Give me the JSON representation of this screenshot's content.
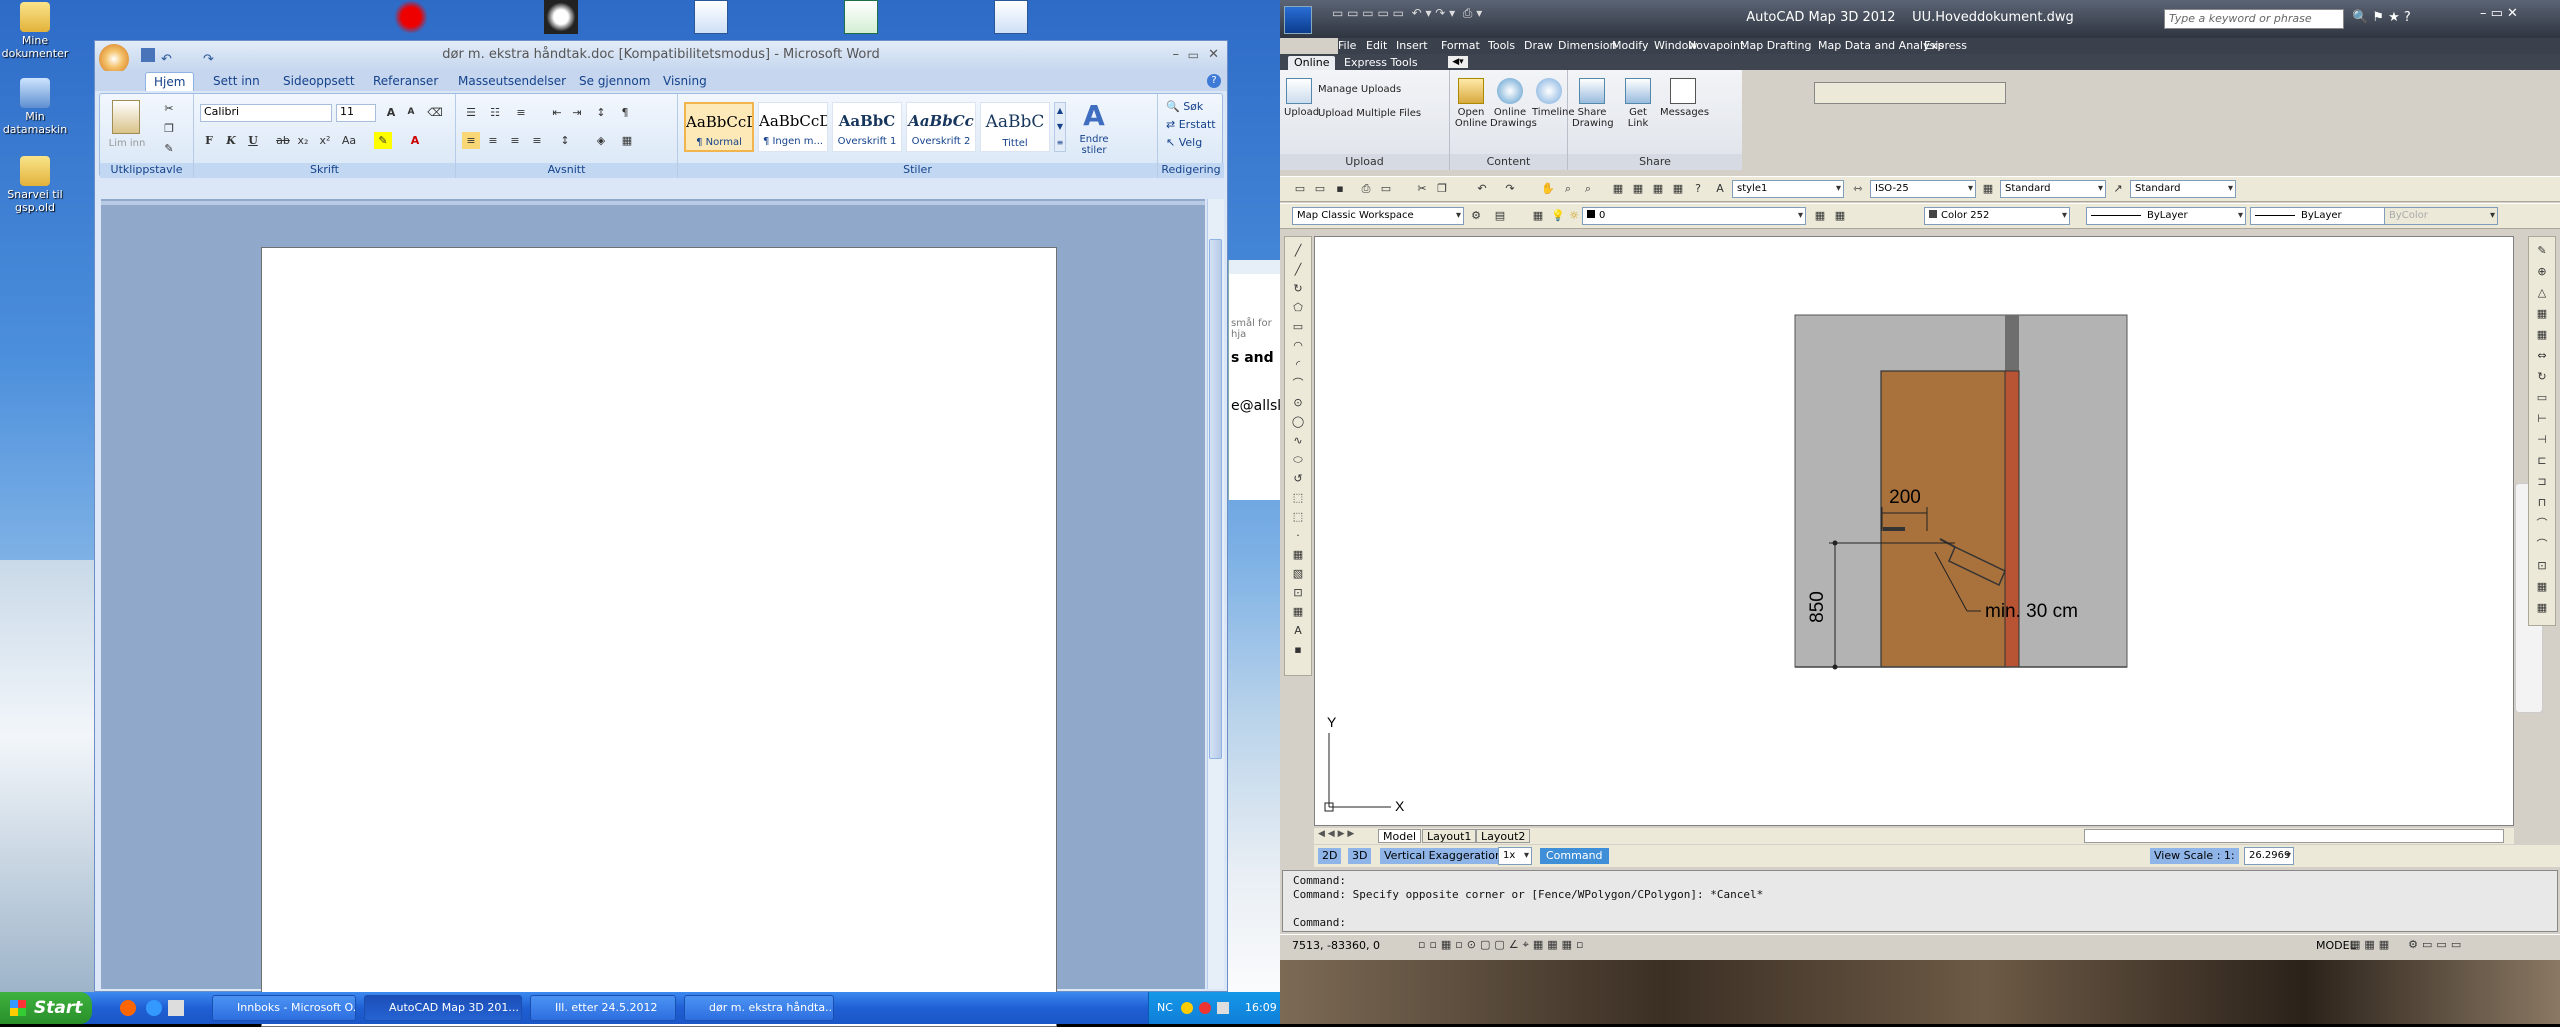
{
  "desktop": {
    "icons": [
      {
        "label": "Mine\ndokumenter"
      },
      {
        "label": "Min\ndatamaskin"
      },
      {
        "label": "Snarvei til\ngsp.old"
      }
    ]
  },
  "word": {
    "title": "dør m. ekstra håndtak.doc [Kompatibilitetsmodus] - Microsoft Word",
    "tabs": [
      "Hjem",
      "Sett inn",
      "Sideoppsett",
      "Referanser",
      "Masseutsendelser",
      "Se gjennom",
      "Visning"
    ],
    "font_name": "Calibri",
    "font_size": "11",
    "paste_label": "Lim inn",
    "groups": {
      "clipboard": "Utklippstavle",
      "font": "Skrift",
      "paragraph": "Avsnitt",
      "styles": "Stiler",
      "editing": "Redigering"
    },
    "styles": [
      {
        "preview": "AaBbCcDc",
        "name": "¶ Normal"
      },
      {
        "preview": "AaBbCcDc",
        "name": "¶ Ingen m..."
      },
      {
        "preview": "AaBbC",
        "name": "Overskrift 1"
      },
      {
        "preview": "AaBbCc",
        "name": "Overskrift 2"
      },
      {
        "preview": "AaBbC",
        "name": "Tittel"
      }
    ],
    "change_styles": "Endre stiler",
    "editing": {
      "find": "Søk",
      "replace": "Erstatt",
      "select": "Velg"
    },
    "bold": "F",
    "italic": "K",
    "underline": "U"
  },
  "peek_window": {
    "lines": [
      "smål for hja",
      "s and",
      "e@allsk"
    ]
  },
  "taskbar": {
    "start": "Start",
    "tasks": [
      {
        "label": "Innboks - Microsoft O..."
      },
      {
        "label": "AutoCAD Map 3D 201..."
      },
      {
        "label": "Ill. etter 24.5.2012"
      },
      {
        "label": "dør m. ekstra håndta..."
      }
    ],
    "lang": "NC",
    "clock": "16:09"
  },
  "acad": {
    "app": "AutoCAD Map 3D 2012",
    "file": "UU.Hoveddokument.dwg",
    "search_placeholder": "Type a keyword or phrase",
    "menu": [
      "File",
      "Edit",
      "Insert",
      "Format",
      "Tools",
      "Draw",
      "Dimension",
      "Modify",
      "Window",
      "Novapoint",
      "Map Drafting",
      "Map Data and Analysis",
      "Express"
    ],
    "ribbon_tabs": [
      "Online",
      "Express Tools"
    ],
    "upload_group": {
      "label": "Upload",
      "upload": "Upload",
      "manage": "Manage Uploads",
      "multiple": "Upload Multiple Files"
    },
    "content_group": {
      "label": "Content",
      "open": "Open Online",
      "drawings": "Online Drawings",
      "timeline": "Timeline"
    },
    "share_group": {
      "label": "Share",
      "share": "Share Drawing",
      "getlink": "Get Link",
      "messages": "Messages"
    },
    "text_style": "style1",
    "dim_style": "ISO-25",
    "table_style": "Standard",
    "ml_style": "Standard",
    "workspace": "Map Classic Workspace",
    "layer": "0",
    "color": "Color 252",
    "linetype": "ByLayer",
    "lineweight": "ByLayer",
    "plotstyle": "ByColor",
    "drawing": {
      "dim_200": "200",
      "dim_850": "850",
      "note": "min. 30 cm"
    },
    "ucs": {
      "x": "X",
      "y": "Y"
    },
    "layout_tabs": [
      "Model",
      "Layout1",
      "Layout2"
    ],
    "status1": {
      "d2": "2D",
      "d3": "3D",
      "vex": "Vertical Exaggeration:",
      "vex_val": "1x",
      "command": "Command",
      "view_scale": "View Scale : 1:",
      "scale_val": "26.2969"
    },
    "command_lines": [
      "Command:",
      "Command: Specify opposite corner or [Fence/WPolygon/CPolygon]: *Cancel*",
      "",
      "Command:"
    ],
    "coords": "7513, -83360, 0",
    "model": "MODEL"
  }
}
